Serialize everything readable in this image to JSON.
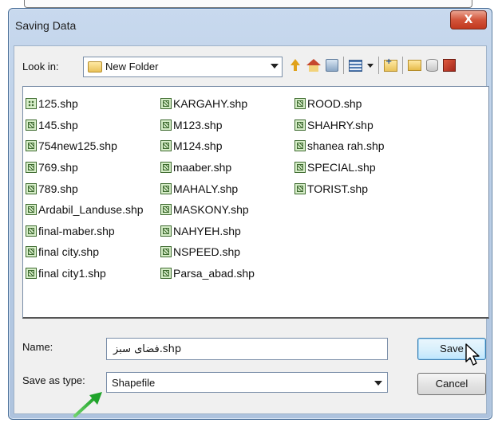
{
  "window": {
    "title": "Saving Data",
    "close_label": "X"
  },
  "lookin": {
    "label": "Look in:",
    "value": "New Folder"
  },
  "toolbar": {
    "icons": [
      "up-folder-icon",
      "home-icon",
      "connect-folder-icon",
      "list-view-icon",
      "new-folder-icon",
      "folder-icon",
      "database-icon",
      "toolbox-icon"
    ]
  },
  "files": {
    "col1": [
      "125.shp",
      "145.shp",
      "754new125.shp",
      "769.shp",
      "789.shp",
      "Ardabil_Landuse.shp",
      "final-maber.shp",
      "final city.shp",
      "final city1.shp"
    ],
    "col2": [
      "KARGAHY.shp",
      "M123.shp",
      "M124.shp",
      "maaber.shp",
      "MAHALY.shp",
      "MASKONY.shp",
      "NAHYEH.shp",
      "NSPEED.shp",
      "Parsa_abad.shp"
    ],
    "col3": [
      "ROOD.shp",
      "SHAHRY.shp",
      "shanea rah.shp",
      "SPECIAL.shp",
      "TORIST.shp"
    ]
  },
  "name_field": {
    "label": "Name:",
    "value": "فضای سبز.shp"
  },
  "type_field": {
    "label": "Save as type:",
    "value": "Shapefile"
  },
  "buttons": {
    "save": "Save",
    "cancel": "Cancel"
  }
}
